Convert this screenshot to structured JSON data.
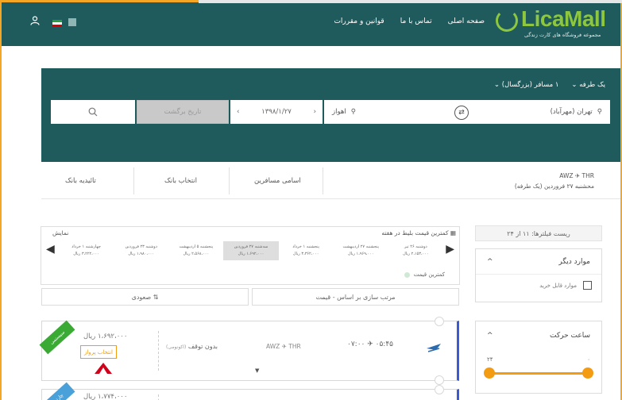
{
  "header": {
    "nav": [
      "صفحه اصلی",
      "تماس با ما",
      "قوانین و مقررات"
    ],
    "logo_text": "LicaMall",
    "logo_tagline": "مجموعه فروشگاه های کارت زندگی",
    "brand_color": "#8dc63f",
    "header_color": "#1f5b5c"
  },
  "search": {
    "trip_type": "یک طرفه",
    "passengers": "۱ مسافر (بزرگسال)",
    "from": "تهران (مهرآباد)",
    "to": "اهواز",
    "depart_date": "۱۳۹۸/۱/۲۷",
    "return_placeholder": "تاریخ برگشت"
  },
  "steps": {
    "route_codes": "AWZ ✈ THR",
    "route_date": "محشنبه ۲۷ فروردین (یک طرفه)",
    "items": [
      "اسامی مسافرین",
      "انتخاب بانک",
      "تائیدیه بانک"
    ]
  },
  "filters": {
    "summary": "ریست فیلترها: ۱۱ از ۲۴",
    "other_title": "موارد دیگر",
    "refundable_label": "موارد قابل خرید",
    "time_title": "ساعت حرکت",
    "time_min": "۰",
    "time_max": "۲۴"
  },
  "cheap": {
    "title": "کمترین قیمت بلیط در هفته",
    "show_label": "نمایش",
    "legend": "کمترین قیمت",
    "days": [
      {
        "date": "دوشنبه ۲۶ تیر",
        "price": "۲،۱۵۳،۰۰۰ ریال"
      },
      {
        "date": "پنجشنبه ۲۷ اردیبهشت",
        "price": "۱،۹۶۹،۰۰۰ ریال"
      },
      {
        "date": "پنجشنبه ۱ خرداد",
        "price": "۳،۳۶۲،۰۰۰ ریال"
      },
      {
        "date": "سه‌شنبه ۲۷ فروردین",
        "price": "۱،۶۹۲،۰۰۰ ریال"
      },
      {
        "date": "پنجشنبه ۵ اردیبهشت",
        "price": "۲،۵۶۸،۰۰۰ ریال"
      },
      {
        "date": "دوشنبه ۲۳ فروردین",
        "price": "۱،۹۸۰،۰۰۰ ریال"
      },
      {
        "date": "چهارشنبه ۱ خرداد",
        "price": "۳،۲۲۲،۰۰۰ ریال"
      }
    ],
    "selected_index": 3
  },
  "sort": {
    "by_label": "مرتب سازی بر اساس - قیمت",
    "order_label": "صعودی"
  },
  "flights": [
    {
      "badge": "سیستمی",
      "price": "۱،۶۹۲،۰۰۰ ریال",
      "button": "انتخاب پرواز",
      "stops": "بدون توقف",
      "class": "(اکونومی)",
      "route": "AWZ ✈ THR",
      "arrive": "۰۷:۰۰",
      "depart": "۰۵:۴۵"
    },
    {
      "badge": "چارتری",
      "price": "۱،۷۷۴،۰۰۰ ریال"
    }
  ]
}
